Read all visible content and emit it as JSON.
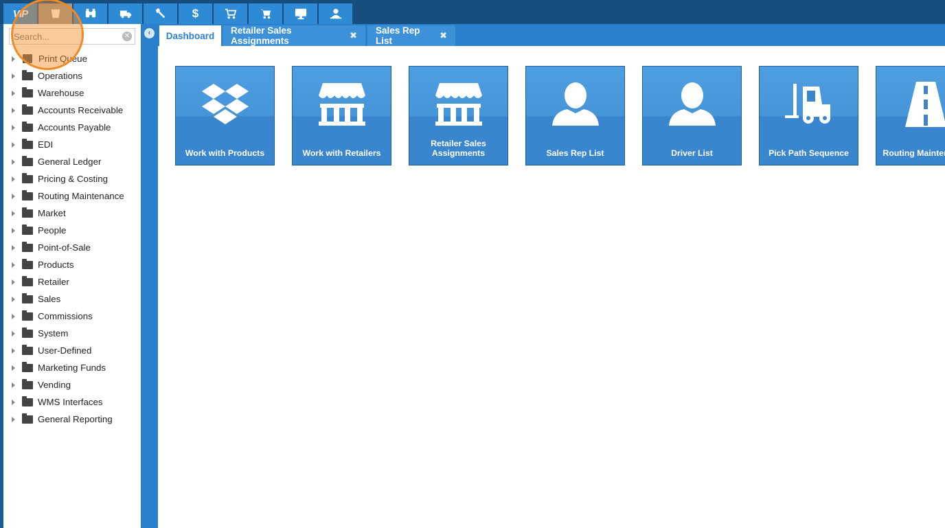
{
  "toolbar": {
    "logo": "VIP",
    "buttons": [
      "pail-icon",
      "binoculars-icon",
      "truck-icon",
      "wrench-icon",
      "dollar-icon",
      "cart-icon",
      "cart-alt-icon",
      "monitor-icon",
      "user-network-icon"
    ],
    "active_index": 0
  },
  "sidebar": {
    "search_placeholder": "Search...",
    "items": [
      {
        "label": "Print Queue",
        "icon": "printer-icon"
      },
      {
        "label": "Operations",
        "icon": "folder-icon"
      },
      {
        "label": "Warehouse",
        "icon": "folder-icon"
      },
      {
        "label": "Accounts Receivable",
        "icon": "folder-icon"
      },
      {
        "label": "Accounts Payable",
        "icon": "folder-icon"
      },
      {
        "label": "EDI",
        "icon": "folder-icon"
      },
      {
        "label": "General Ledger",
        "icon": "folder-icon"
      },
      {
        "label": "Pricing & Costing",
        "icon": "folder-icon"
      },
      {
        "label": "Routing Maintenance",
        "icon": "folder-icon"
      },
      {
        "label": "Market",
        "icon": "folder-icon"
      },
      {
        "label": "People",
        "icon": "folder-icon"
      },
      {
        "label": "Point-of-Sale",
        "icon": "folder-icon"
      },
      {
        "label": "Products",
        "icon": "folder-icon"
      },
      {
        "label": "Retailer",
        "icon": "folder-icon"
      },
      {
        "label": "Sales",
        "icon": "folder-icon"
      },
      {
        "label": "Commissions",
        "icon": "folder-icon"
      },
      {
        "label": "System",
        "icon": "folder-icon"
      },
      {
        "label": "User-Defined",
        "icon": "folder-icon"
      },
      {
        "label": "Marketing Funds",
        "icon": "folder-icon"
      },
      {
        "label": "Vending",
        "icon": "folder-icon"
      },
      {
        "label": "WMS Interfaces",
        "icon": "folder-icon"
      },
      {
        "label": "General Reporting",
        "icon": "folder-icon"
      }
    ]
  },
  "tabs": [
    {
      "label": "Dashboard",
      "active": true,
      "closable": false
    },
    {
      "label": "Retailer Sales Assignments",
      "active": false,
      "closable": true
    },
    {
      "label": "Sales Rep List",
      "active": false,
      "closable": true
    }
  ],
  "tiles": [
    {
      "label": "Work with Products",
      "icon": "dropbox-icon"
    },
    {
      "label": "Work with Retailers",
      "icon": "storefront-icon"
    },
    {
      "label": "Retailer Sales Assignments",
      "icon": "storefront-icon"
    },
    {
      "label": "Sales Rep List",
      "icon": "person-icon"
    },
    {
      "label": "Driver List",
      "icon": "person-icon"
    },
    {
      "label": "Pick Path Sequence",
      "icon": "forklift-icon"
    },
    {
      "label": "Routing Maintenance",
      "icon": "road-icon"
    }
  ],
  "colors": {
    "toolbar_bg": "#174e7e",
    "toolbar_button": "#2e8ad4",
    "accent": "#2a80cc",
    "tile": "#3a86ce",
    "highlight": "#f08a24"
  }
}
